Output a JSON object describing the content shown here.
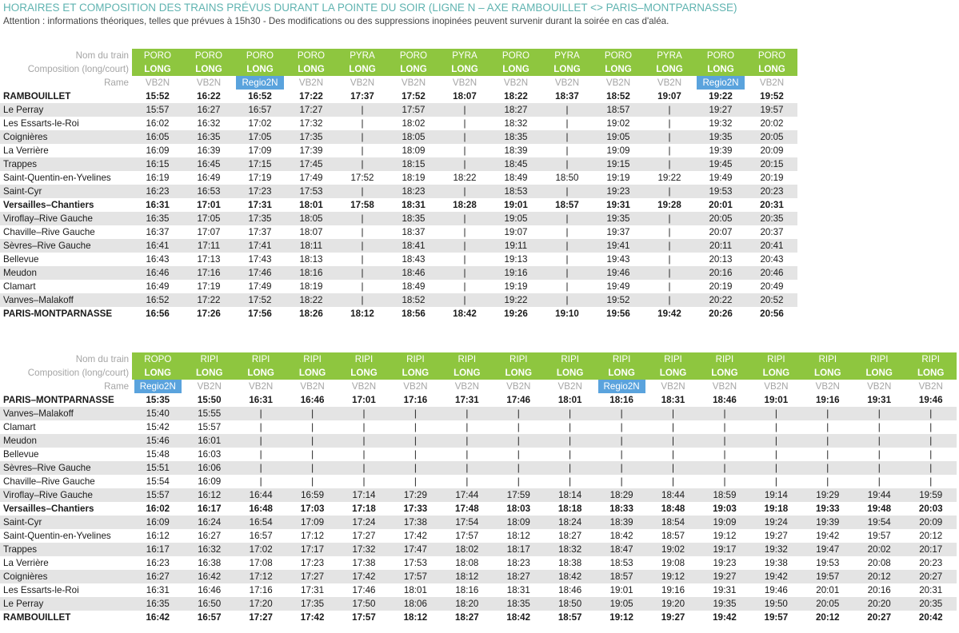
{
  "title": "HORAIRES ET COMPOSITION DES TRAINS PRÉVUS DURANT LA POINTE DU SOIR (LIGNE N – AXE RAMBOUILLET <> PARIS–MONTPARNASSE)",
  "note": "Attention : informations théoriques, telles que prévues à 15h30 - Des modifications ou des suppressions inopinées peuvent survenir durant la soirée en cas d'aléa.",
  "labels": {
    "train_name": "Nom du train",
    "composition": "Composition (long/court)",
    "rame": "Rame"
  },
  "tables": [
    {
      "trains": [
        "PORO",
        "PORO",
        "PORO",
        "PORO",
        "PYRA",
        "PORO",
        "PYRA",
        "PORO",
        "PYRA",
        "PORO",
        "PYRA",
        "PORO",
        "PORO"
      ],
      "composition": [
        "LONG",
        "LONG",
        "LONG",
        "LONG",
        "LONG",
        "LONG",
        "LONG",
        "LONG",
        "LONG",
        "LONG",
        "LONG",
        "LONG",
        "LONG"
      ],
      "rame": [
        "VB2N",
        "VB2N",
        "Regio2N",
        "VB2N",
        "VB2N",
        "VB2N",
        "VB2N",
        "VB2N",
        "VB2N",
        "VB2N",
        "VB2N",
        "Regio2N",
        "VB2N"
      ],
      "rows": [
        {
          "station": "RAMBOUILLET",
          "bold": true,
          "times": [
            "15:52",
            "16:22",
            "16:52",
            "17:22",
            "17:37",
            "17:52",
            "18:07",
            "18:22",
            "18:37",
            "18:52",
            "19:07",
            "19:22",
            "19:52"
          ]
        },
        {
          "station": "Le Perray",
          "times": [
            "15:57",
            "16:27",
            "16:57",
            "17:27",
            "|",
            "17:57",
            "|",
            "18:27",
            "|",
            "18:57",
            "|",
            "19:27",
            "19:57"
          ]
        },
        {
          "station": "Les Essarts-le-Roi",
          "times": [
            "16:02",
            "16:32",
            "17:02",
            "17:32",
            "|",
            "18:02",
            "|",
            "18:32",
            "|",
            "19:02",
            "|",
            "19:32",
            "20:02"
          ]
        },
        {
          "station": "Coignières",
          "times": [
            "16:05",
            "16:35",
            "17:05",
            "17:35",
            "|",
            "18:05",
            "|",
            "18:35",
            "|",
            "19:05",
            "|",
            "19:35",
            "20:05"
          ]
        },
        {
          "station": "La Verrière",
          "times": [
            "16:09",
            "16:39",
            "17:09",
            "17:39",
            "|",
            "18:09",
            "|",
            "18:39",
            "|",
            "19:09",
            "|",
            "19:39",
            "20:09"
          ]
        },
        {
          "station": "Trappes",
          "times": [
            "16:15",
            "16:45",
            "17:15",
            "17:45",
            "|",
            "18:15",
            "|",
            "18:45",
            "|",
            "19:15",
            "|",
            "19:45",
            "20:15"
          ]
        },
        {
          "station": "Saint-Quentin-en-Yvelines",
          "times": [
            "16:19",
            "16:49",
            "17:19",
            "17:49",
            "17:52",
            "18:19",
            "18:22",
            "18:49",
            "18:50",
            "19:19",
            "19:22",
            "19:49",
            "20:19"
          ]
        },
        {
          "station": "Saint-Cyr",
          "times": [
            "16:23",
            "16:53",
            "17:23",
            "17:53",
            "|",
            "18:23",
            "|",
            "18:53",
            "|",
            "19:23",
            "|",
            "19:53",
            "20:23"
          ]
        },
        {
          "station": "Versailles–Chantiers",
          "bold": true,
          "times": [
            "16:31",
            "17:01",
            "17:31",
            "18:01",
            "17:58",
            "18:31",
            "18:28",
            "19:01",
            "18:57",
            "19:31",
            "19:28",
            "20:01",
            "20:31"
          ]
        },
        {
          "station": "Viroflay–Rive Gauche",
          "times": [
            "16:35",
            "17:05",
            "17:35",
            "18:05",
            "|",
            "18:35",
            "|",
            "19:05",
            "|",
            "19:35",
            "|",
            "20:05",
            "20:35"
          ]
        },
        {
          "station": "Chaville–Rive Gauche",
          "times": [
            "16:37",
            "17:07",
            "17:37",
            "18:07",
            "|",
            "18:37",
            "|",
            "19:07",
            "|",
            "19:37",
            "|",
            "20:07",
            "20:37"
          ]
        },
        {
          "station": "Sèvres–Rive Gauche",
          "times": [
            "16:41",
            "17:11",
            "17:41",
            "18:11",
            "|",
            "18:41",
            "|",
            "19:11",
            "|",
            "19:41",
            "|",
            "20:11",
            "20:41"
          ]
        },
        {
          "station": "Bellevue",
          "times": [
            "16:43",
            "17:13",
            "17:43",
            "18:13",
            "|",
            "18:43",
            "|",
            "19:13",
            "|",
            "19:43",
            "|",
            "20:13",
            "20:43"
          ]
        },
        {
          "station": "Meudon",
          "times": [
            "16:46",
            "17:16",
            "17:46",
            "18:16",
            "|",
            "18:46",
            "|",
            "19:16",
            "|",
            "19:46",
            "|",
            "20:16",
            "20:46"
          ]
        },
        {
          "station": "Clamart",
          "times": [
            "16:49",
            "17:19",
            "17:49",
            "18:19",
            "|",
            "18:49",
            "|",
            "19:19",
            "|",
            "19:49",
            "|",
            "20:19",
            "20:49"
          ]
        },
        {
          "station": "Vanves–Malakoff",
          "times": [
            "16:52",
            "17:22",
            "17:52",
            "18:22",
            "|",
            "18:52",
            "|",
            "19:22",
            "|",
            "19:52",
            "|",
            "20:22",
            "20:52"
          ]
        },
        {
          "station": "PARIS-MONTPARNASSE",
          "bold": true,
          "times": [
            "16:56",
            "17:26",
            "17:56",
            "18:26",
            "18:12",
            "18:56",
            "18:42",
            "19:26",
            "19:10",
            "19:56",
            "19:42",
            "20:26",
            "20:56"
          ]
        }
      ]
    },
    {
      "trains": [
        "ROPO",
        "RIPI",
        "RIPI",
        "RIPI",
        "RIPI",
        "RIPI",
        "RIPI",
        "RIPI",
        "RIPI",
        "RIPI",
        "RIPI",
        "RIPI",
        "RIPI",
        "RIPI",
        "RIPI",
        "RIPI"
      ],
      "composition": [
        "LONG",
        "LONG",
        "LONG",
        "LONG",
        "LONG",
        "LONG",
        "LONG",
        "LONG",
        "LONG",
        "LONG",
        "LONG",
        "LONG",
        "LONG",
        "LONG",
        "LONG",
        "LONG"
      ],
      "rame": [
        "Regio2N",
        "VB2N",
        "VB2N",
        "VB2N",
        "VB2N",
        "VB2N",
        "VB2N",
        "VB2N",
        "VB2N",
        "Regio2N",
        "VB2N",
        "VB2N",
        "VB2N",
        "VB2N",
        "VB2N",
        "VB2N"
      ],
      "rows": [
        {
          "station": "PARIS–MONTPARNASSE",
          "bold": true,
          "times": [
            "15:35",
            "15:50",
            "16:31",
            "16:46",
            "17:01",
            "17:16",
            "17:31",
            "17:46",
            "18:01",
            "18:16",
            "18:31",
            "18:46",
            "19:01",
            "19:16",
            "19:31",
            "19:46"
          ]
        },
        {
          "station": "Vanves–Malakoff",
          "times": [
            "15:40",
            "15:55",
            "|",
            "|",
            "|",
            "|",
            "|",
            "|",
            "|",
            "|",
            "|",
            "|",
            "|",
            "|",
            "|",
            "|"
          ]
        },
        {
          "station": "Clamart",
          "times": [
            "15:42",
            "15:57",
            "|",
            "|",
            "|",
            "|",
            "|",
            "|",
            "|",
            "|",
            "|",
            "|",
            "|",
            "|",
            "|",
            "|"
          ]
        },
        {
          "station": "Meudon",
          "times": [
            "15:46",
            "16:01",
            "|",
            "|",
            "|",
            "|",
            "|",
            "|",
            "|",
            "|",
            "|",
            "|",
            "|",
            "|",
            "|",
            "|"
          ]
        },
        {
          "station": "Bellevue",
          "times": [
            "15:48",
            "16:03",
            "|",
            "|",
            "|",
            "|",
            "|",
            "|",
            "|",
            "|",
            "|",
            "|",
            "|",
            "|",
            "|",
            "|"
          ]
        },
        {
          "station": "Sèvres–Rive Gauche",
          "times": [
            "15:51",
            "16:06",
            "|",
            "|",
            "|",
            "|",
            "|",
            "|",
            "|",
            "|",
            "|",
            "|",
            "|",
            "|",
            "|",
            "|"
          ]
        },
        {
          "station": "Chaville–Rive Gauche",
          "times": [
            "15:54",
            "16:09",
            "|",
            "|",
            "|",
            "|",
            "|",
            "|",
            "|",
            "|",
            "|",
            "|",
            "|",
            "|",
            "|",
            "|"
          ]
        },
        {
          "station": "Viroflay–Rive Gauche",
          "times": [
            "15:57",
            "16:12",
            "16:44",
            "16:59",
            "17:14",
            "17:29",
            "17:44",
            "17:59",
            "18:14",
            "18:29",
            "18:44",
            "18:59",
            "19:14",
            "19:29",
            "19:44",
            "19:59"
          ]
        },
        {
          "station": "Versailles–Chantiers",
          "bold": true,
          "times": [
            "16:02",
            "16:17",
            "16:48",
            "17:03",
            "17:18",
            "17:33",
            "17:48",
            "18:03",
            "18:18",
            "18:33",
            "18:48",
            "19:03",
            "19:18",
            "19:33",
            "19:48",
            "20:03"
          ]
        },
        {
          "station": "Saint-Cyr",
          "times": [
            "16:09",
            "16:24",
            "16:54",
            "17:09",
            "17:24",
            "17:38",
            "17:54",
            "18:09",
            "18:24",
            "18:39",
            "18:54",
            "19:09",
            "19:24",
            "19:39",
            "19:54",
            "20:09"
          ]
        },
        {
          "station": "Saint-Quentin-en-Yvelines",
          "times": [
            "16:12",
            "16:27",
            "16:57",
            "17:12",
            "17:27",
            "17:42",
            "17:57",
            "18:12",
            "18:27",
            "18:42",
            "18:57",
            "19:12",
            "19:27",
            "19:42",
            "19:57",
            "20:12"
          ]
        },
        {
          "station": "Trappes",
          "times": [
            "16:17",
            "16:32",
            "17:02",
            "17:17",
            "17:32",
            "17:47",
            "18:02",
            "18:17",
            "18:32",
            "18:47",
            "19:02",
            "19:17",
            "19:32",
            "19:47",
            "20:02",
            "20:17"
          ]
        },
        {
          "station": "La Verrière",
          "times": [
            "16:23",
            "16:38",
            "17:08",
            "17:23",
            "17:38",
            "17:53",
            "18:08",
            "18:23",
            "18:38",
            "18:53",
            "19:08",
            "19:23",
            "19:38",
            "19:53",
            "20:08",
            "20:23"
          ]
        },
        {
          "station": "Coignières",
          "times": [
            "16:27",
            "16:42",
            "17:12",
            "17:27",
            "17:42",
            "17:57",
            "18:12",
            "18:27",
            "18:42",
            "18:57",
            "19:12",
            "19:27",
            "19:42",
            "19:57",
            "20:12",
            "20:27"
          ]
        },
        {
          "station": "Les Essarts-le-Roi",
          "times": [
            "16:31",
            "16:46",
            "17:16",
            "17:31",
            "17:46",
            "18:01",
            "18:16",
            "18:31",
            "18:46",
            "19:01",
            "19:16",
            "19:31",
            "19:46",
            "20:01",
            "20:16",
            "20:31"
          ]
        },
        {
          "station": "Le Perray",
          "times": [
            "16:35",
            "16:50",
            "17:20",
            "17:35",
            "17:50",
            "18:06",
            "18:20",
            "18:35",
            "18:50",
            "19:05",
            "19:20",
            "19:35",
            "19:50",
            "20:05",
            "20:20",
            "20:35"
          ]
        },
        {
          "station": "RAMBOUILLET",
          "bold": true,
          "times": [
            "16:42",
            "16:57",
            "17:27",
            "17:42",
            "17:57",
            "18:12",
            "18:27",
            "18:42",
            "18:57",
            "19:12",
            "19:27",
            "19:42",
            "19:57",
            "20:12",
            "20:27",
            "20:42"
          ]
        }
      ]
    }
  ]
}
